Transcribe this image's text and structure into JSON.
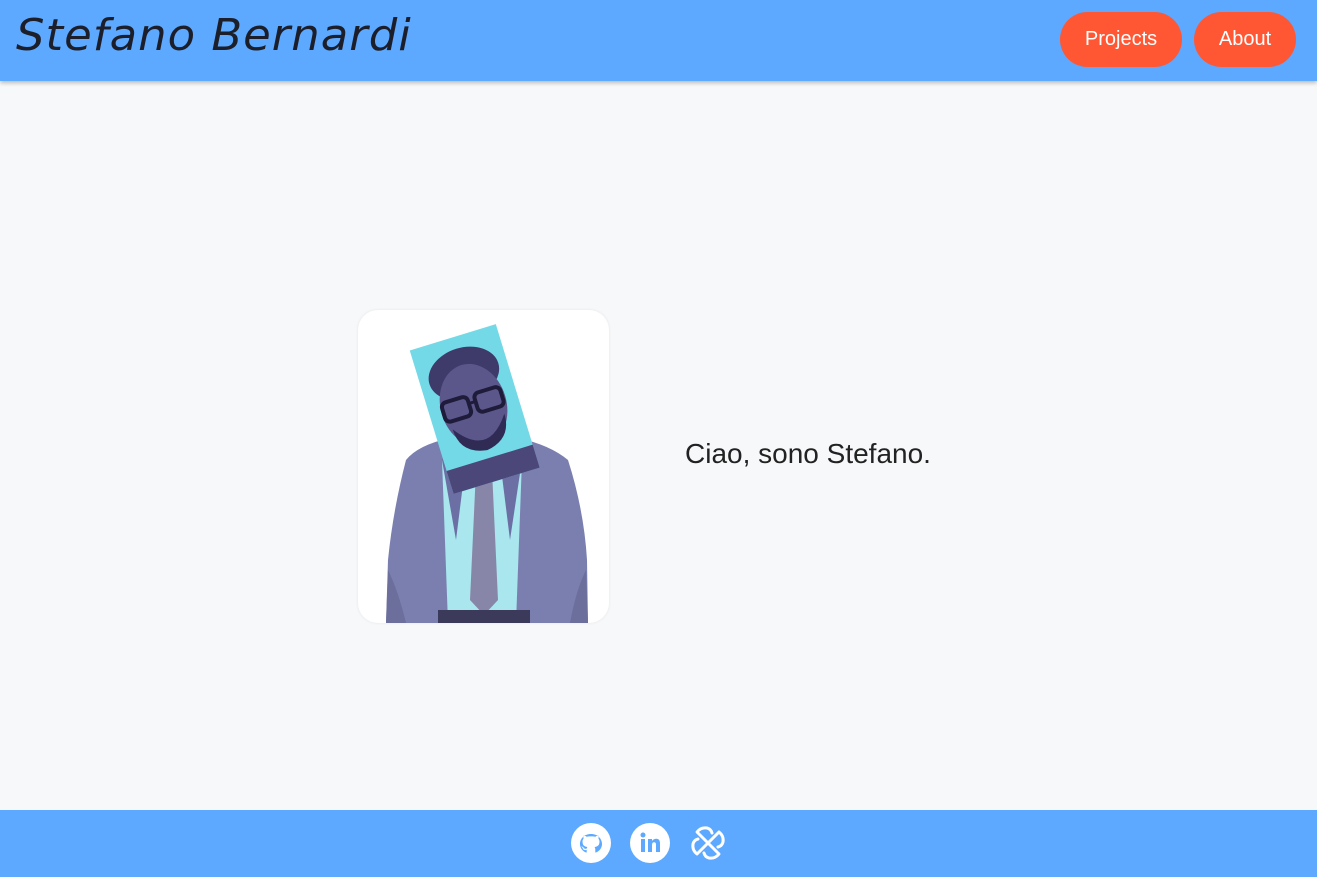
{
  "header": {
    "title": "Stefano Bernardi",
    "nav": {
      "projects_label": "Projects",
      "about_label": "About"
    }
  },
  "main": {
    "greeting": "Ciao, sono Stefano."
  },
  "footer": {
    "icons": [
      "github-icon",
      "linkedin-icon",
      "slack-icon"
    ]
  },
  "colors": {
    "header_bg": "#5ca9ff",
    "button_bg": "#ff5733",
    "page_bg": "#f7f8fa"
  }
}
